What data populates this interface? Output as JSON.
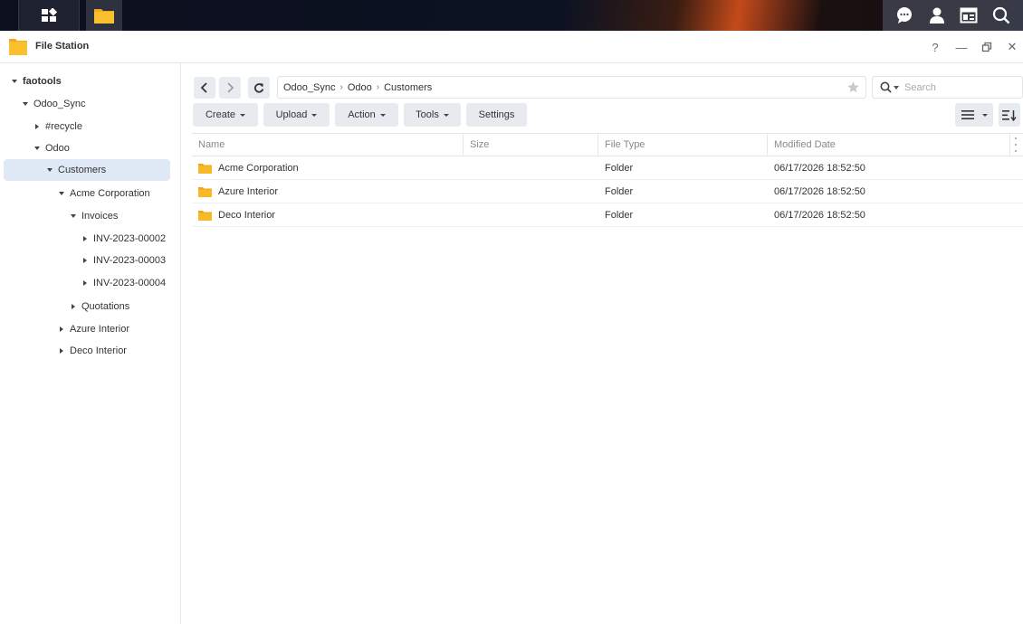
{
  "window": {
    "title": "File Station",
    "help": "?",
    "minimize": "—",
    "close": "✕"
  },
  "sidebar": {
    "items": [
      {
        "label": "faotools",
        "expanded": true
      },
      {
        "label": "Odoo_Sync",
        "expanded": true
      },
      {
        "label": "#recycle",
        "expanded": false
      },
      {
        "label": "Odoo",
        "expanded": true
      },
      {
        "label": "Customers",
        "expanded": true,
        "selected": true
      },
      {
        "label": "Acme Corporation",
        "expanded": true
      },
      {
        "label": "Invoices",
        "expanded": true
      },
      {
        "label": "INV-2023-00002",
        "expanded": false
      },
      {
        "label": "INV-2023-00003",
        "expanded": false
      },
      {
        "label": "INV-2023-00004",
        "expanded": false
      },
      {
        "label": "Quotations",
        "expanded": false
      },
      {
        "label": "Azure Interior",
        "expanded": false
      },
      {
        "label": "Deco Interior",
        "expanded": false
      }
    ]
  },
  "path": {
    "crumbs": [
      "Odoo_Sync",
      "Odoo",
      "Customers"
    ]
  },
  "search": {
    "placeholder": "Search"
  },
  "toolbar": {
    "create": "Create",
    "upload": "Upload",
    "action": "Action",
    "tools": "Tools",
    "settings": "Settings"
  },
  "table": {
    "columns": [
      "Name",
      "Size",
      "File Type",
      "Modified Date"
    ],
    "rows": [
      {
        "name": "Acme Corporation",
        "size": "",
        "type": "Folder",
        "modified": "06/17/2026 18:52:50"
      },
      {
        "name": "Azure Interior",
        "size": "",
        "type": "Folder",
        "modified": "06/17/2026 18:52:50"
      },
      {
        "name": "Deco Interior",
        "size": "",
        "type": "Folder",
        "modified": "06/17/2026 18:52:50"
      }
    ]
  },
  "colors": {
    "folder": "#f7b928",
    "selection": "#dfe9f6",
    "button_bg": "#e7ebf0"
  }
}
